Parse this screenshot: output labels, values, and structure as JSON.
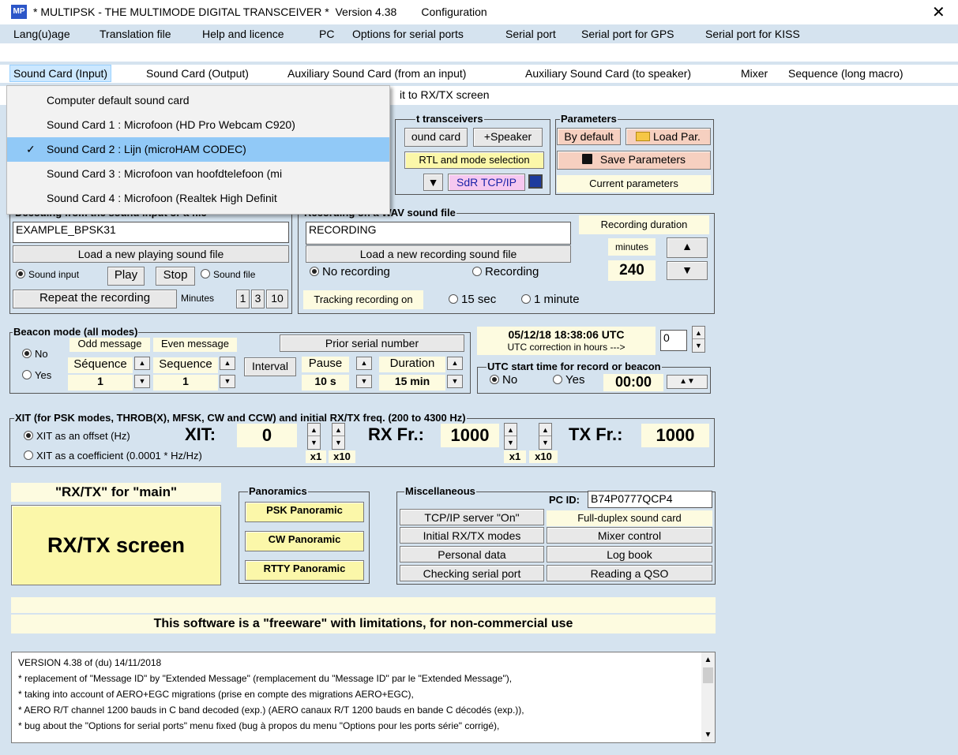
{
  "window": {
    "title": "* MULTIPSK - THE MULTIMODE DIGITAL TRANSCEIVER *  Version 4.38        Configuration",
    "close": "✕",
    "icon_text": "MP"
  },
  "menu1": [
    "Lang(u)age",
    "Translation file",
    "Help and licence",
    "PC",
    "Options for serial ports",
    "Serial port",
    "Serial port for GPS",
    "Serial port for KISS"
  ],
  "menu2": [
    "Sound Card (Input)",
    "Sound Card (Output)",
    "Auxiliary Sound Card (from an input)",
    "Auxiliary Sound Card (to speaker)",
    "Mixer",
    "Sequence (long macro)"
  ],
  "menu3_visible": "it to RX/TX screen",
  "dropdown": {
    "items": [
      "Computer default sound card",
      "Sound Card 1 : Microfoon (HD Pro Webcam C920)",
      "Sound Card 2 : Lijn (microHAM CODEC)",
      "Sound Card 3 : Microfoon van hoofdtelefoon (mi",
      "Sound Card 4 : Microfoon (Realtek High Definit"
    ],
    "selected_index": 2,
    "check": "✓"
  },
  "transceivers": {
    "label": "t transceivers",
    "sound_card": "ound card",
    "speaker": "+Speaker",
    "rtl": "RTL and mode selection",
    "sdr": "SdR TCP/IP"
  },
  "parameters": {
    "label": "Parameters",
    "default": "By default",
    "load": "Load Par.",
    "save": "Save Parameters",
    "current": "Current parameters"
  },
  "decoding": {
    "label": "Decoding from the sound input or a file",
    "file": "EXAMPLE_BPSK31",
    "load": "Load a new playing sound file",
    "sound_input": "Sound input",
    "play": "Play",
    "stop": "Stop",
    "sound_file": "Sound file",
    "repeat": "Repeat the recording",
    "minutes": "Minutes",
    "m1": "1",
    "m3": "3",
    "m10": "10"
  },
  "recording": {
    "label": "Recording on a WAV sound file",
    "file": "RECORDING",
    "load": "Load a new recording sound file",
    "no_rec": "No recording",
    "rec": "Recording",
    "tracking": "Tracking recording on",
    "s15": "15 sec",
    "m1": "1 minute",
    "duration_label": "Recording duration",
    "minutes": "minutes",
    "value": "240"
  },
  "beacon": {
    "label": "Beacon mode (all modes)",
    "no": "No",
    "yes": "Yes",
    "odd": "Odd message",
    "even": "Even message",
    "seq1": "Séquence",
    "seq2": "Sequence",
    "v1": "1",
    "v2": "1",
    "interval": "Interval",
    "prior": "Prior serial number",
    "pause": "Pause",
    "pause_v": "10 s",
    "duration": "Duration",
    "duration_v": "15 min"
  },
  "utc": {
    "time": "05/12/18 18:38:06 UTC",
    "correction": "UTC correction in hours --->",
    "corr_v": "0",
    "start_label": "UTC start time for record or beacon",
    "no": "No",
    "yes": "Yes",
    "start_v": "00:00"
  },
  "xit": {
    "label": "XIT (for PSK modes, THROB(X), MFSK, CW and CCW) and initial RX/TX freq. (200 to 4300 Hz)",
    "offset": "XIT as an offset (Hz)",
    "coef": "XIT as a coefficient (0.0001 * Hz/Hz)",
    "xit_label": "XIT:",
    "xit_v": "0",
    "rx_label": "RX Fr.:",
    "rx_v": "1000",
    "tx_label": "TX Fr.:",
    "tx_v": "1000",
    "x1": "x1",
    "x10": "x10"
  },
  "rxtx": {
    "label": "\"RX/TX\" for \"main\"",
    "button": "RX/TX screen"
  },
  "panoramics": {
    "label": "Panoramics",
    "psk": "PSK Panoramic",
    "cw": "CW Panoramic",
    "rtty": "RTTY Panoramic"
  },
  "misc": {
    "label": "Miscellaneous",
    "pcid_label": "PC ID:",
    "pcid": "B74P0777QCP4",
    "tcp": "TCP/IP server \"On\"",
    "duplex": "Full-duplex sound card",
    "initial": "Initial RX/TX modes",
    "mixer": "Mixer control",
    "personal": "Personal data",
    "log": "Log book",
    "checking": "Checking serial port",
    "reading": "Reading a QSO"
  },
  "freeware": "This software is a \"freeware\" with limitations, for non-commercial use",
  "log": [
    "VERSION 4.38 of (du) 14/11/2018",
    " * replacement of \"Message ID\" by \"Extended Message\" (remplacement du \"Message ID\" par le \"Extended Message\"),",
    " * taking into account of AERO+EGC migrations (prise en compte des migrations AERO+EGC),",
    " * AERO R/T channel 1200 bauds in C band decoded (exp.) (AERO canaux R/T 1200 bauds en bande C décodés (exp.)),",
    " * bug about the \"Options for serial ports\" menu fixed (bug à propos du menu \"Options pour les ports série\" corrigé),"
  ]
}
